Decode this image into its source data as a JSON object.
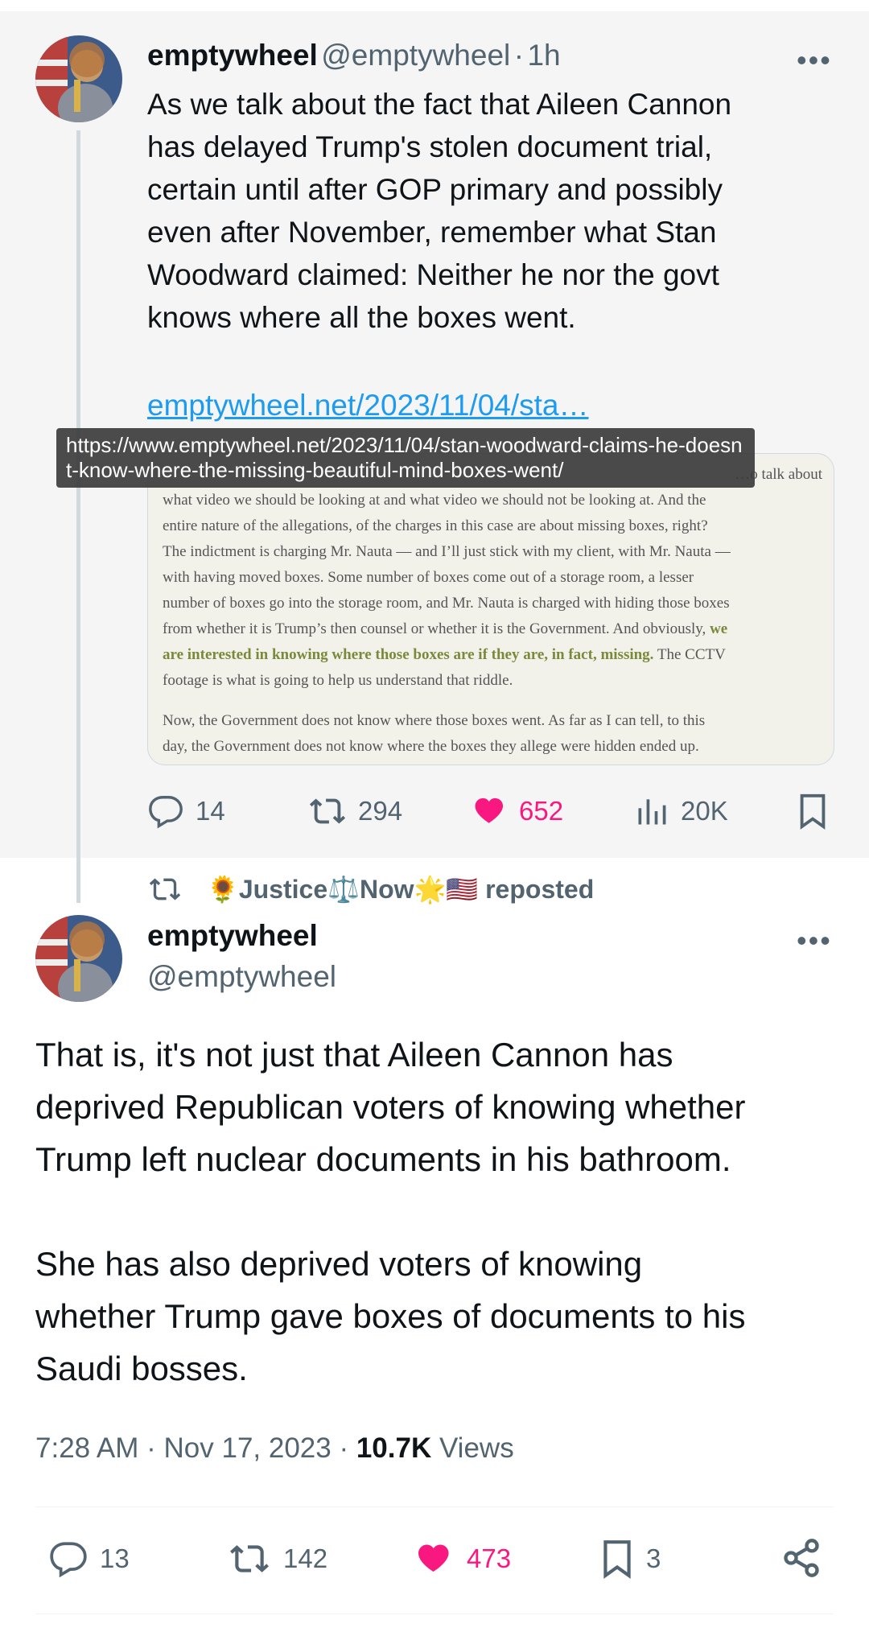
{
  "parent_tweet": {
    "author_name": "emptywheel",
    "author_handle": "@emptywheel",
    "separator": "·",
    "time": "1h",
    "more": "•••",
    "text_lines": [
      "As we talk about the fact that Aileen Cannon",
      "has delayed Trump's stolen document trial,",
      "certain until after GOP primary and possibly",
      "even after November, remember what Stan",
      "Woodward claimed: Neither he nor the govt",
      "knows where all the boxes went."
    ],
    "link_text": "emptywheel.net/2023/11/04/sta…",
    "link_tooltip": "https://www.emptywheel.net/2023/11/04/stan-woodward-claims-he-doesnt-know-where-the-missing-beautiful-mind-boxes-went/",
    "card": {
      "line0": "…o talk about",
      "line1": "what video we should be looking at and what video we should not be looking at. And the",
      "lines": [
        "entire nature of the allegations, of the charges in this case are about missing boxes, right?",
        "The indictment is charging Mr. Nauta — and I’ll just stick with my client, with Mr. Nauta —",
        "with having moved boxes. Some number of boxes come out of a storage room, a lesser",
        "number of boxes go into the storage room, and Mr. Nauta is charged with hiding those boxes"
      ],
      "line_hl_pre": "from whether it is Trump’s then counsel or whether it is the Government. And obviously,",
      "line_hl_a": "we",
      "line_hl_b": "are interested in knowing where those boxes are if they are, in fact, missing.",
      "line_hl_post": "The CCTV",
      "line_last": "footage is what is going to help us understand that riddle.",
      "para2_line1": "Now, the Government does not know where those boxes went. As far as I can tell, to this",
      "para2_line2": "day, the Government does not know where the boxes they allege were hidden ended up."
    },
    "actions": {
      "replies": "14",
      "reposts": "294",
      "likes": "652",
      "views": "20K"
    }
  },
  "repost_banner": {
    "reposter": "🌻Justice⚖️Now🌟🇺🇸",
    "suffix": " reposted"
  },
  "main_tweet": {
    "author_name": "emptywheel",
    "author_handle": "@emptywheel",
    "more": "•••",
    "paragraph1_lines": [
      "That is, it's not just that Aileen Cannon has",
      "deprived Republican voters of knowing whether",
      "Trump left nuclear documents in his bathroom."
    ],
    "paragraph2_lines": [
      "She has also deprived voters of knowing",
      "whether Trump gave boxes of documents to his",
      "Saudi bosses."
    ],
    "timestamp": "7:28 AM · Nov 17, 2023 · ",
    "views_count": "10.7K",
    "views_label": " Views",
    "actions": {
      "replies": "13",
      "reposts": "142",
      "likes": "473",
      "bookmarks": "3"
    }
  },
  "colors": {
    "link": "#1d9bf0",
    "like": "#f91880",
    "muted": "#536471"
  }
}
